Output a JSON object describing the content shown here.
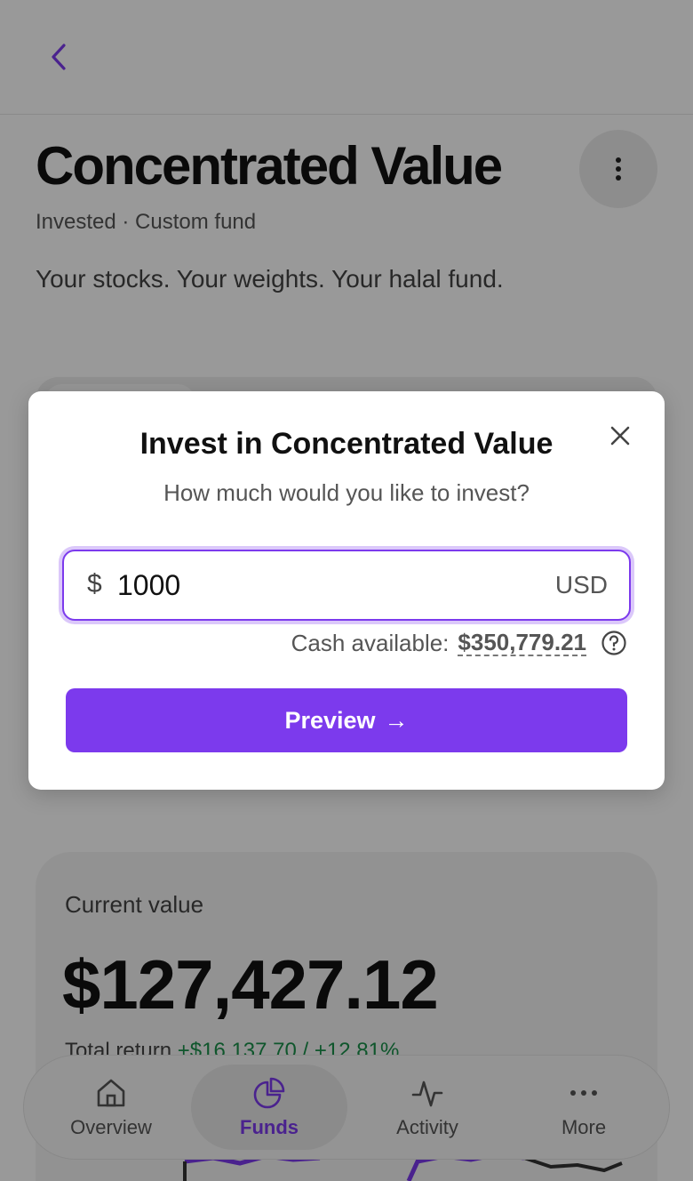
{
  "header": {
    "back_icon": "chevron-left-icon",
    "more_icon": "more-vertical-icon"
  },
  "fund": {
    "title": "Concentrated Value",
    "subtitle": "Invested · Custom fund",
    "description": "Your stocks. Your weights. Your halal fund."
  },
  "value_card": {
    "label": "Current value",
    "amount": "$127,427.12",
    "return_label": "Total return",
    "return_value": "+$16,137.70 / +12.81%"
  },
  "modal": {
    "title": "Invest in Concentrated Value",
    "subtitle": "How much would you like to invest?",
    "currency_symbol": "$",
    "amount_value": "1000",
    "currency_code": "USD",
    "cash_label": "Cash available:",
    "cash_amount": "$350,779.21",
    "preview_label": "Preview",
    "preview_arrow": "→"
  },
  "nav": {
    "items": [
      {
        "label": "Overview",
        "icon": "home-icon",
        "active": false
      },
      {
        "label": "Funds",
        "icon": "pie-chart-icon",
        "active": true
      },
      {
        "label": "Activity",
        "icon": "activity-icon",
        "active": false
      },
      {
        "label": "More",
        "icon": "more-horizontal-icon",
        "active": false
      }
    ]
  },
  "colors": {
    "accent": "#7c3aed",
    "positive": "#1a8f4a"
  }
}
